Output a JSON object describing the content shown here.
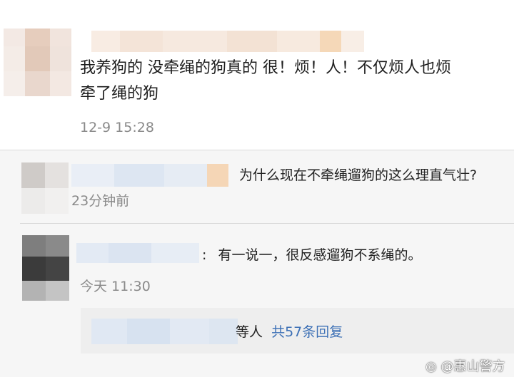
{
  "main_comment": {
    "line1": "我养狗的 没牵绳的狗真的 很！烦！人！不仅烦人也烦",
    "line2": "牵了绳的狗",
    "time": "12-9 15:28"
  },
  "reply1": {
    "text": "为什么现在不牵绳遛狗的这么理直气壮?",
    "time": "23分钟前"
  },
  "reply2": {
    "colon": ":",
    "text": "有一说一，很反感遛狗不系绳的。",
    "time": "今天 11:30"
  },
  "more_replies": {
    "prefix": "等人",
    "link": "共57条回复"
  },
  "watermark": {
    "text": "@惠山警方"
  },
  "colors": {
    "link": "#3b6fb5",
    "time": "#8a8a8a",
    "reply_bg": "#f6f6f6"
  }
}
